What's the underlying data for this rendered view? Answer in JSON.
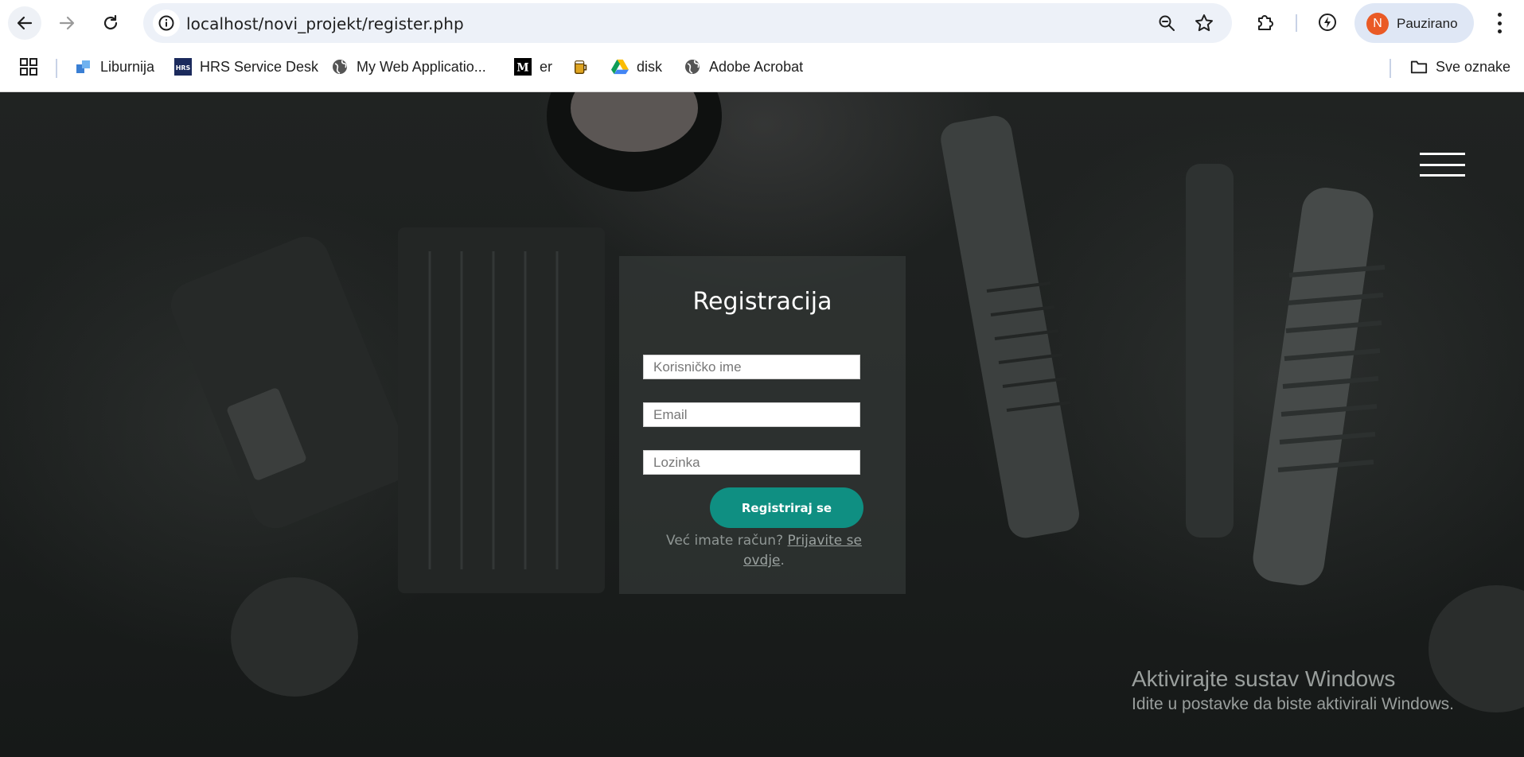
{
  "browser": {
    "url": "localhost/novi_projekt/register.php",
    "profile_initial": "N",
    "profile_name": "Pauzirano",
    "bookmarks": [
      {
        "label": "Liburnija",
        "icon": "liburnija-icon"
      },
      {
        "label": "HRS Service Desk",
        "icon": "hrs-icon"
      },
      {
        "label": "My Web Applicatio...",
        "icon": "globe-icon"
      },
      {
        "label": "er",
        "icon": "medium-icon"
      },
      {
        "label": "",
        "icon": "beer-icon"
      },
      {
        "label": "disk",
        "icon": "google-drive-icon"
      },
      {
        "label": "Adobe Acrobat",
        "icon": "globe-icon"
      }
    ],
    "all_bookmarks_label": "Sve oznake"
  },
  "page": {
    "title": "Registracija",
    "username_placeholder": "Korisničko ime",
    "email_placeholder": "Email",
    "password_placeholder": "Lozinka",
    "submit_label": "Registriraj se",
    "login_prompt": "Već imate račun?",
    "login_link": "Prijavite se ovdje",
    "login_suffix": "."
  },
  "windows_watermark": {
    "line1": "Aktivirajte sustav Windows",
    "line2": "Idite u postavke da biste aktivirali Windows."
  },
  "colors": {
    "accent": "#0f8f82",
    "profile_avatar": "#ea5a25"
  }
}
